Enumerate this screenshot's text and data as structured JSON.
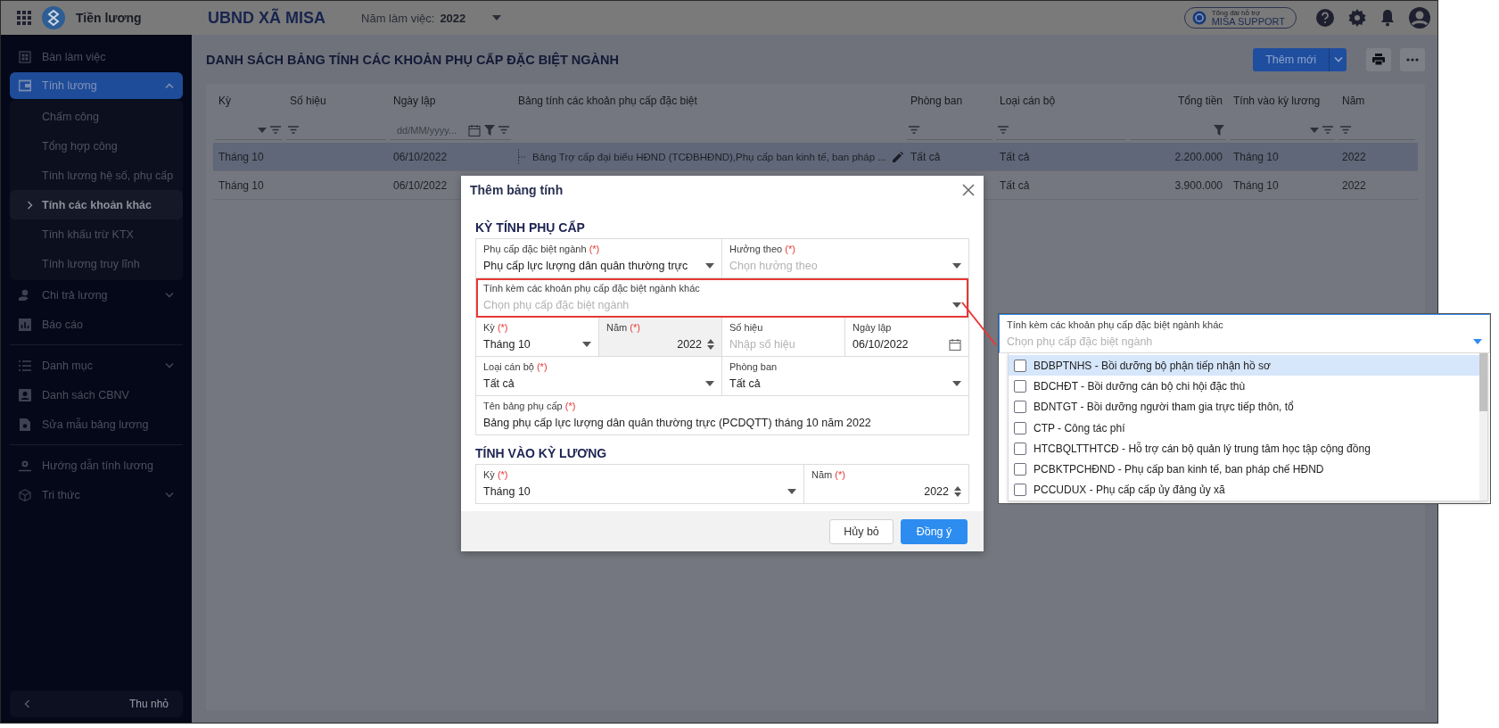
{
  "app": {
    "name": "Tiền lương",
    "organization": "UBND XÃ MISA",
    "year_label": "Năm làm việc:",
    "year": "2022",
    "support": {
      "caption": "Tổng đài hỗ trợ",
      "label": "MISA SUPPORT"
    }
  },
  "sidebar": {
    "groups": [
      {
        "items": [
          {
            "label": "Bàn làm việc",
            "selected": false
          },
          {
            "label": "Tính lương",
            "selected": true,
            "expanded": true,
            "children": [
              {
                "label": "Chấm công",
                "selected": false
              },
              {
                "label": "Tổng hợp công",
                "selected": false
              },
              {
                "label": "Tính lương hệ số, phụ cấp",
                "selected": false
              },
              {
                "label": "Tính các khoản khác",
                "selected": true
              },
              {
                "label": "Tính khấu trừ KTX",
                "selected": false
              },
              {
                "label": "Tính lương truy lĩnh",
                "selected": false
              }
            ]
          },
          {
            "label": "Chi trả lương",
            "selected": false,
            "expanded": false
          },
          {
            "label": "Báo cáo",
            "selected": false
          }
        ]
      },
      {
        "items": [
          {
            "label": "Danh mục",
            "selected": false,
            "expanded": false
          },
          {
            "label": "Danh sách CBNV",
            "selected": false
          },
          {
            "label": "Sửa mẫu bảng lương",
            "selected": false
          }
        ]
      },
      {
        "items": [
          {
            "label": "Hướng dẫn tính lương",
            "selected": false
          },
          {
            "label": "Tri thức",
            "selected": false,
            "expanded": false
          }
        ]
      }
    ],
    "collapse_label": "Thu nhỏ"
  },
  "page": {
    "title": "DANH SÁCH BẢNG TÍNH CÁC KHOẢN PHỤ CẤP ĐẶC BIỆT NGÀNH",
    "add_button": "Thêm mới"
  },
  "table": {
    "columns": [
      {
        "label": "Kỳ",
        "kind": "select"
      },
      {
        "label": "Số hiệu",
        "kind": "text"
      },
      {
        "label": "Ngày lập",
        "kind": "date",
        "placeholder": "dd/MM/yyyy..."
      },
      {
        "label": "Bảng tính các khoản phụ cấp đặc biệt",
        "kind": "tree"
      },
      {
        "label": "Phòng ban",
        "kind": "text"
      },
      {
        "label": "Loại cán bộ",
        "kind": "text"
      },
      {
        "label": "Tổng tiền",
        "kind": "money"
      },
      {
        "label": "Tính vào kỳ lương",
        "kind": "select"
      },
      {
        "label": "Năm",
        "kind": "text"
      }
    ],
    "rows": [
      {
        "selected": true,
        "cells": [
          "Tháng 10",
          null,
          "06/10/2022",
          "Bảng Trợ cấp đại biểu HĐND (TCĐBHĐND),Phụ cấp ban kinh tế, ban pháp ...",
          "Tất cả",
          "Tất cả",
          "2.200.000",
          "Tháng 10",
          "2022"
        ]
      },
      {
        "selected": false,
        "cells": [
          "Tháng 10",
          null,
          "06/10/2022",
          null,
          null,
          "Tất cả",
          "3.900.000",
          "Tháng 10",
          "2022"
        ]
      }
    ]
  },
  "dialog": {
    "title": "Thêm bảng tính",
    "sections": [
      {
        "title": "KỲ TÍNH PHỤ CẤP",
        "rows": [
          [
            {
              "label": "Phụ cấp đặc biệt ngành",
              "required_mark": "(*)",
              "kind": "select",
              "value": "Phụ cấp lực lượng dân quân thường trực",
              "disabled": false,
              "highlighted": false,
              "colspan": 2
            },
            {
              "label": "Hưởng theo",
              "required_mark": "(*)",
              "kind": "select",
              "placeholder": "Chọn hưởng theo",
              "disabled": false,
              "highlighted": false,
              "colspan": 2
            }
          ],
          [
            {
              "label": "Tính kèm các khoản phụ cấp đặc biệt ngành khác",
              "kind": "select",
              "placeholder": "Chọn phụ cấp đặc biệt ngành",
              "disabled": false,
              "highlighted": true,
              "colspan": 4
            }
          ],
          [
            {
              "label": "Kỳ",
              "required_mark": "(*)",
              "kind": "select",
              "value": "Tháng 10",
              "disabled": false,
              "highlighted": false
            },
            {
              "label": "Năm",
              "required_mark": "(*)",
              "kind": "number",
              "value": "2022",
              "disabled": true,
              "highlighted": false
            },
            {
              "label": "Số hiệu",
              "kind": "text",
              "placeholder": "Nhập số hiệu",
              "disabled": false,
              "highlighted": false
            },
            {
              "label": "Ngày lập",
              "kind": "date",
              "value": "06/10/2022",
              "disabled": false,
              "highlighted": false
            }
          ],
          [
            {
              "label": "Loại cán bộ",
              "required_mark": "(*)",
              "kind": "select",
              "value": "Tất cả",
              "disabled": false,
              "highlighted": false,
              "colspan": 2
            },
            {
              "label": "Phòng ban",
              "kind": "select",
              "value": "Tất cả",
              "disabled": false,
              "highlighted": false,
              "colspan": 2
            }
          ],
          [
            {
              "label": "Tên bảng phụ cấp",
              "required_mark": "(*)",
              "kind": "text",
              "value": "Bảng phụ cấp lực lượng dân quân thường trực (PCDQTT) tháng 10 năm 2022",
              "disabled": false,
              "highlighted": false,
              "colspan": 4
            }
          ]
        ]
      },
      {
        "title": "TÍNH VÀO KỲ LƯƠNG",
        "rows": [
          [
            {
              "label": "Kỳ",
              "required_mark": "(*)",
              "kind": "select",
              "value": "Tháng 10",
              "disabled": false,
              "highlighted": false,
              "colspan": 2
            },
            {
              "label": "Năm",
              "required_mark": "(*)",
              "kind": "number",
              "value": "2022",
              "disabled": false,
              "highlighted": false
            }
          ]
        ]
      }
    ],
    "buttons": [
      {
        "label": "Hủy bỏ",
        "kind": "secondary"
      },
      {
        "label": "Đồng ý",
        "kind": "primary"
      }
    ]
  },
  "callout": {
    "label": "Tính kèm các khoản phụ cấp đặc biệt ngành khác",
    "placeholder": "Chọn phụ cấp đặc biệt ngành",
    "options": [
      {
        "label": "BDBPTNHS - Bồi dưỡng bộ phận tiếp nhận hồ sơ",
        "checked": false,
        "selected": true
      },
      {
        "label": "BDCHĐT - Bồi dưỡng cán bộ chi hội đặc thù",
        "checked": false,
        "selected": false
      },
      {
        "label": "BDNTGT - Bồi dưỡng người tham gia trực tiếp thôn, tổ",
        "checked": false,
        "selected": false
      },
      {
        "label": "CTP - Công tác phí",
        "checked": false,
        "selected": false
      },
      {
        "label": "HTCBQLTTHTCĐ - Hỗ trợ cán bộ quản lý trung tâm học tập cộng đồng",
        "checked": false,
        "selected": false
      },
      {
        "label": "PCBKTPCHĐND - Phụ cấp ban kinh tế, ban pháp chế HĐND",
        "checked": false,
        "selected": false
      },
      {
        "label": "PCCUDUX - Phụ cấp cấp ủy đảng ủy xã",
        "checked": false,
        "selected": false
      }
    ]
  }
}
